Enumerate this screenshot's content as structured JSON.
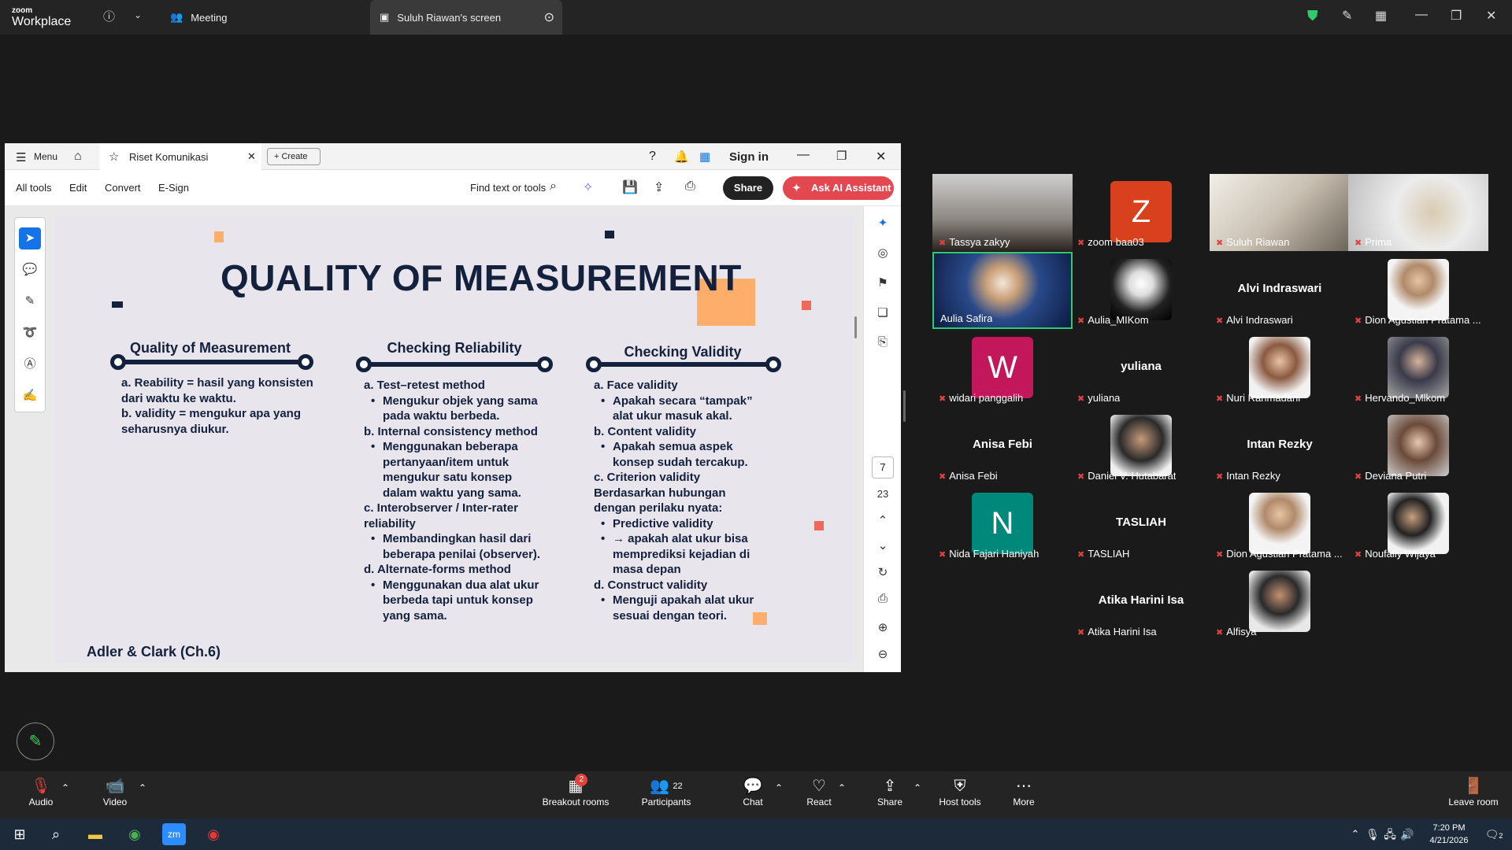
{
  "zoom": {
    "logo_top": "zoom",
    "logo_bottom": "Workplace",
    "tabs": [
      {
        "label": "Meeting"
      },
      {
        "label": "Suluh Riawan's screen"
      }
    ]
  },
  "acrobat": {
    "menu_label": "Menu",
    "doc_tab": "Riset Komunikasi",
    "create_label": "Create",
    "sign_in": "Sign in",
    "toolbar": [
      "All tools",
      "Edit",
      "Convert",
      "E-Sign"
    ],
    "find_label": "Find text or tools",
    "share_label": "Share",
    "ai_label": "Ask AI Assistant",
    "page_current": "7",
    "page_total": "23"
  },
  "slide": {
    "title": "QUALITY OF MEASUREMENT",
    "col1_heading": "Quality of Measurement",
    "col1_lines": [
      "a. Reability = hasil yang konsisten",
      "dari waktu ke waktu.",
      "b. validity = mengukur apa yang",
      "seharusnya diukur."
    ],
    "col2_heading": "Checking Reliability",
    "col2": {
      "a": "a. Test–retest method",
      "a1": "Mengukur objek yang sama",
      "a2": "pada waktu berbeda.",
      "b": "b. Internal consistency method",
      "b1": "Menggunakan beberapa",
      "b2": "pertanyaan/item untuk",
      "b3": "mengukur satu konsep",
      "b4": "dalam waktu yang sama.",
      "c": "c. Interobserver / Inter-rater",
      "c0": "reliability",
      "c1": "Membandingkan hasil dari",
      "c2": "beberapa penilai (observer).",
      "d": "d. Alternate-forms method",
      "d1": "Menggunakan dua alat ukur",
      "d2": "berbeda tapi untuk konsep",
      "d3": "yang sama."
    },
    "col3_heading": "Checking Validity",
    "col3": {
      "a": "a. Face validity",
      "a1": "Apakah secara “tampak”",
      "a2": "alat ukur masuk akal.",
      "b": "b. Content validity",
      "b1": "Apakah semua aspek",
      "b2": "konsep sudah tercakup.",
      "c": "c. Criterion validity",
      "c0": "Berdasarkan hubungan",
      "c01": "dengan perilaku nyata:",
      "c1": "Predictive validity",
      "c2": "→ apakah alat ukur bisa",
      "c3": "memprediksi kejadian di",
      "c4": "masa depan",
      "d": "d. Construct validity",
      "d1": "Menguji apakah alat ukur",
      "d2": "sesuai dengan teori."
    },
    "citation": "Adler & Clark (Ch.6)"
  },
  "participants": [
    {
      "name": "Tassya zakyy"
    },
    {
      "name": "zoom baa03",
      "letter": "Z"
    },
    {
      "name": "Suluh Riawan"
    },
    {
      "name": "Prima"
    },
    {
      "name": "Aulia Safira"
    },
    {
      "name": "Aulia_MIKom"
    },
    {
      "name": "Alvi Indraswari",
      "big": "Alvi Indraswari"
    },
    {
      "name": "Dion Agustian Pratama ..."
    },
    {
      "name": "widari panggalih",
      "letter": "W"
    },
    {
      "name": "yuliana",
      "big": "yuliana"
    },
    {
      "name": "Nuri Rahmadani"
    },
    {
      "name": "Hervando_Mlkom"
    },
    {
      "name": "Anisa Febi",
      "big": "Anisa Febi"
    },
    {
      "name": "Daniel V. Hutabarat"
    },
    {
      "name": "Intan Rezky",
      "big": "Intan Rezky"
    },
    {
      "name": "Deviana Putri"
    },
    {
      "name": "Nida Fajari Haniyah",
      "letter": "N"
    },
    {
      "name": "TASLIAH",
      "big": "TASLIAH"
    },
    {
      "name": "Dion Agustian Pratama ..."
    },
    {
      "name": "Noufally Wijaya"
    },
    {
      "name": "Atika Harini Isa",
      "big": "Atika Harini Isa"
    },
    {
      "name": "Alfisya"
    }
  ],
  "bottom": {
    "audio": "Audio",
    "video": "Video",
    "breakout": "Breakout rooms",
    "breakout_badge": "2",
    "participants": "Participants",
    "participants_count": "22",
    "chat": "Chat",
    "react": "React",
    "share": "Share",
    "host_tools": "Host tools",
    "more": "More",
    "leave": "Leave room"
  },
  "taskbar": {
    "time": "7:20 PM",
    "date": "4/21/2026",
    "notif": "2"
  },
  "colors": {
    "slide_navy": "#14213d",
    "accent_orange": "#fdae6b",
    "accent_red": "#f0685a",
    "ai_red": "#e34850",
    "speaker_border": "#2ecc71"
  }
}
